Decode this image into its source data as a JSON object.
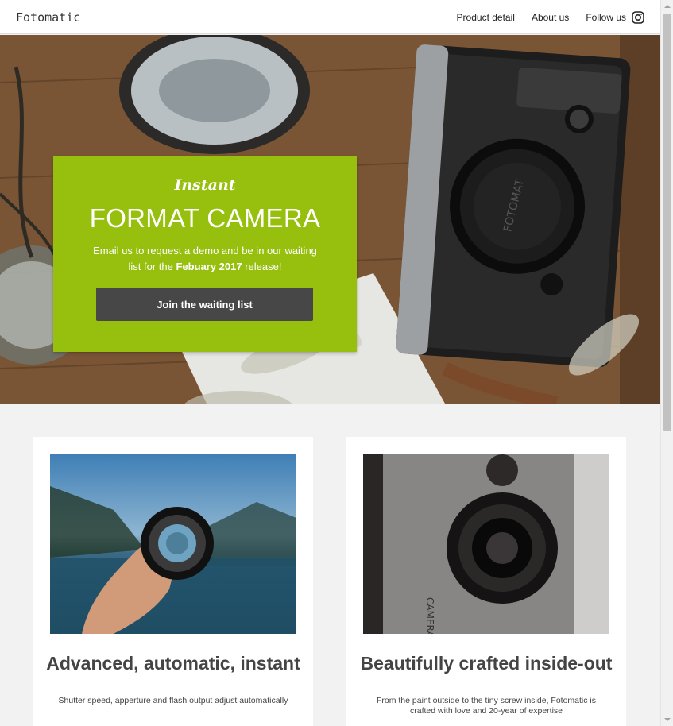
{
  "header": {
    "brand": "Fotomatic",
    "nav": [
      {
        "label": "Product detail"
      },
      {
        "label": "About us"
      },
      {
        "label": "Follow us"
      }
    ],
    "follow_icon": "instagram-icon"
  },
  "hero": {
    "script_title": "Instant",
    "title": "FORMAT CAMERA",
    "desc_part1": "Email us to request a demo and be in our waiting list for the ",
    "desc_bold": "Febuary 2017",
    "desc_part2": " release!",
    "cta_label": "Join the waiting list",
    "camera_brand": "FOTOMAT",
    "accent_color": "#97bf0d"
  },
  "features": [
    {
      "title": "Advanced, automatic, instant",
      "text": "Shutter speed, apperture and flash output adjust automatically"
    },
    {
      "title": "Beautifully crafted inside-out",
      "text": "From the paint outside to the tiny screw inside, Fotomatic is crafted with love and 20-year of expertise",
      "camera_label": "CAMERA"
    }
  ]
}
